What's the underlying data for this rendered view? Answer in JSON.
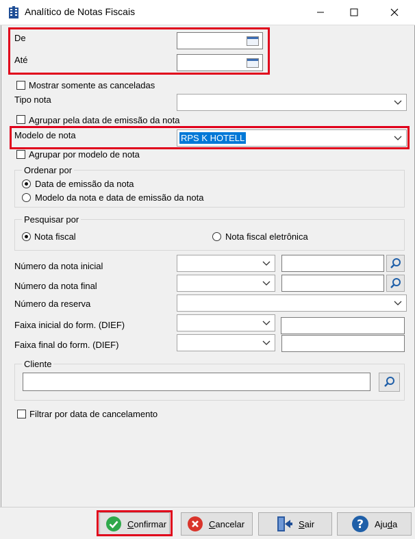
{
  "window": {
    "title": "Analítico de Notas Fiscais"
  },
  "form": {
    "de_label": "De",
    "ate_label": "Até",
    "de_value": "",
    "ate_value": "",
    "mostrar_canceladas": "Mostrar somente as canceladas",
    "tipo_nota_label": "Tipo nota",
    "tipo_nota_value": "",
    "agrupar_data": "Agrupar pela data de emissão da nota",
    "modelo_nota_label": "Modelo de nota",
    "modelo_nota_value": "RPS K HOTELL",
    "agrupar_modelo": "Agrupar por modelo de nota",
    "ordenar": {
      "legend": "Ordenar por",
      "options": [
        "Data de emissão da nota",
        "Modelo da nota e data de emissão da nota"
      ],
      "selected": 0
    },
    "pesquisar": {
      "legend": "Pesquisar por",
      "options": [
        "Nota fiscal",
        "Nota fiscal eletrônica"
      ],
      "selected": 0
    },
    "numero_inicial_label": "Número da nota inicial",
    "numero_final_label": "Número da nota final",
    "numero_reserva_label": "Número da reserva",
    "faixa_inicial_label": "Faixa inicial do form. (DIEF)",
    "faixa_final_label": "Faixa final do form. (DIEF)",
    "cliente_legend": "Cliente",
    "cliente_value": "",
    "filtrar_cancelamento": "Filtrar por data de cancelamento"
  },
  "buttons": {
    "confirmar": {
      "first": "C",
      "rest": "onfirmar"
    },
    "cancelar": {
      "first": "C",
      "rest": "ancelar"
    },
    "sair": {
      "first": "S",
      "rest": "air"
    },
    "ajuda": {
      "pre": "Aju",
      "underlined": "d",
      "post": "a"
    }
  },
  "icons": {
    "app": "hotel-building-icon",
    "confirm": "check-circle-icon",
    "cancel": "x-circle-icon",
    "exit": "exit-door-icon",
    "help": "question-circle-icon",
    "search": "magnifier-icon",
    "calendar": "calendar-icon",
    "dropdown": "chevron-down-icon"
  },
  "colors": {
    "highlight_border": "#e0001b",
    "selection_bg": "#0078d7",
    "confirm_green": "#2ea84a",
    "cancel_red": "#d9342b",
    "help_blue": "#1f5fa8"
  }
}
